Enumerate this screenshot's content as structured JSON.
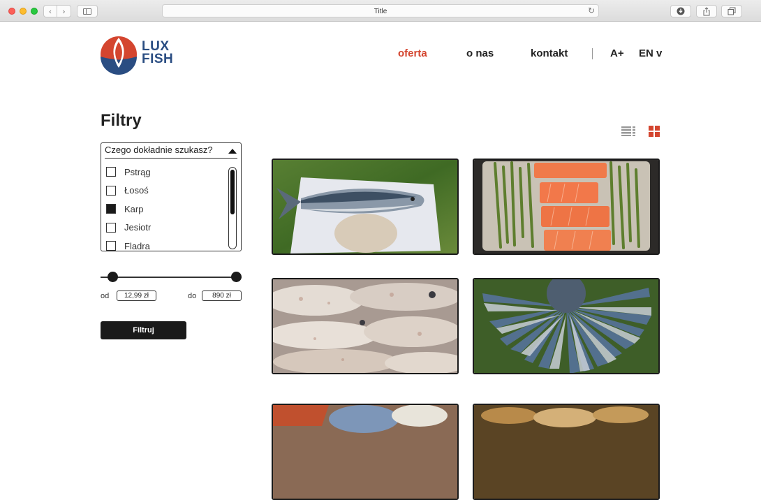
{
  "browser": {
    "tab_title": "Title",
    "icons": [
      "back-icon",
      "forward-icon",
      "sidebar-icon",
      "reload-icon",
      "download-icon",
      "share-icon",
      "tabs-icon"
    ]
  },
  "brand": {
    "line1": "LUX",
    "line2": "FISH",
    "colors": {
      "red": "#d4452f",
      "blue": "#2a4d82"
    }
  },
  "nav": {
    "items": [
      {
        "label": "oferta",
        "active": true
      },
      {
        "label": "o nas",
        "active": false
      },
      {
        "label": "kontakt",
        "active": false
      }
    ],
    "font_size_label": "A+",
    "language_label": "EN v"
  },
  "filters": {
    "title": "Filtry",
    "dropdown_label": "Czego dokładnie szukasz?",
    "options": [
      {
        "label": "Pstrąg",
        "checked": false
      },
      {
        "label": "Łosoś",
        "checked": false
      },
      {
        "label": "Karp",
        "checked": true
      },
      {
        "label": "Jesiotr",
        "checked": false
      },
      {
        "label": "Fladra",
        "checked": false
      }
    ],
    "price": {
      "from_label": "od",
      "from_value": "12,99 zł",
      "to_label": "do",
      "to_value": "890 zł"
    },
    "submit_label": "Filtruj"
  },
  "view": {
    "modes": [
      "list-view-icon",
      "grid-view-icon"
    ],
    "active": "grid"
  },
  "products": [
    {
      "image": "mackerel-on-board"
    },
    {
      "image": "salmon-with-asparagus"
    },
    {
      "image": "raw-squid"
    },
    {
      "image": "sardines-circle"
    },
    {
      "image": "fish-platter"
    },
    {
      "image": "fried-fish"
    }
  ]
}
